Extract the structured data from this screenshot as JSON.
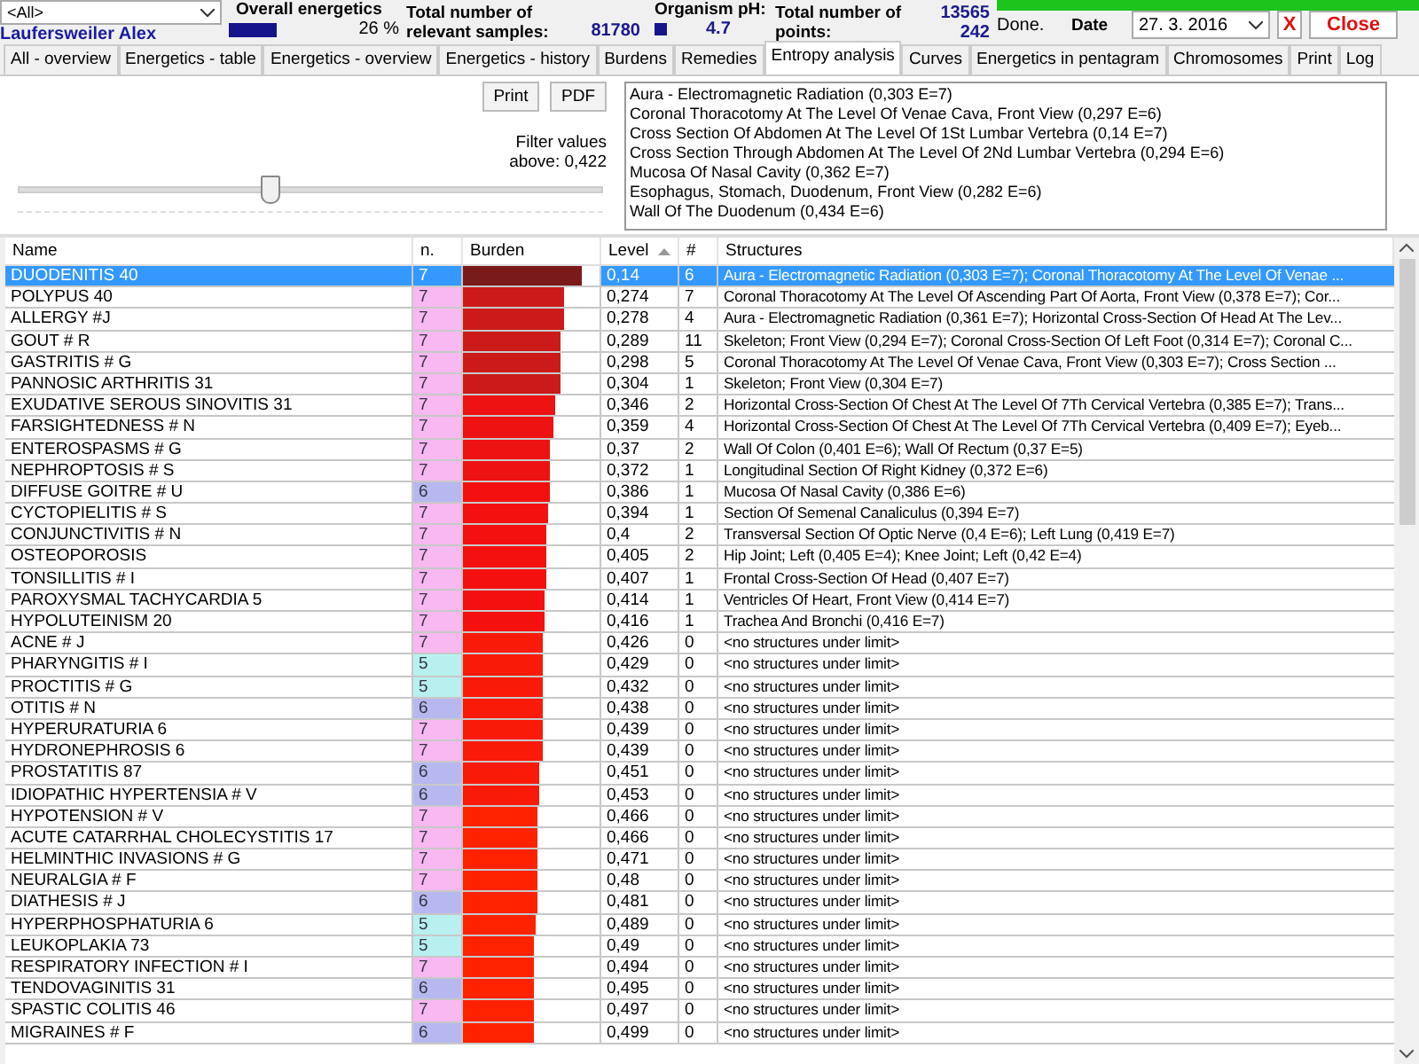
{
  "header": {
    "patient_filter": "<All>",
    "patient_name": "Laufersweiler Alex",
    "overall_label": "Overall energetics",
    "overall_value": "26 %",
    "samples_label": "Total number of relevant samples:",
    "samples_value": "81780",
    "ph_label": "Organism pH:",
    "ph_value": "4.7",
    "points_label": "Total number of points:",
    "points_value_1": "13565",
    "points_value_2": "242",
    "progress": {
      "level": 1
    },
    "status": "Done.",
    "date_label": "Date",
    "date_value": "27. 3. 2016",
    "clear_button": "X",
    "close_button": "Close"
  },
  "tabs": [
    {
      "label": "All - overview",
      "selected": false
    },
    {
      "label": "Energetics - table",
      "selected": false
    },
    {
      "label": "Energetics - overview",
      "selected": false
    },
    {
      "label": "Energetics - history",
      "selected": false
    },
    {
      "label": "Burdens",
      "selected": false
    },
    {
      "label": "Remedies",
      "selected": false
    },
    {
      "label": "Entropy analysis",
      "selected": true
    },
    {
      "label": "Curves",
      "selected": false
    },
    {
      "label": "Energetics in pentagram",
      "selected": false
    },
    {
      "label": "Chromosomes",
      "selected": false
    },
    {
      "label": "Print",
      "selected": false
    },
    {
      "label": "Log",
      "selected": false
    }
  ],
  "panel": {
    "buttons": [
      "Print",
      "PDF"
    ],
    "filter_label": "Filter values above: 0,422",
    "filter_slider": {
      "level": 0.43
    },
    "structures_list": [
      "Aura - Electromagnetic Radiation (0,303 E=7)",
      "Coronal Thoracotomy At The Level Of Venae Cava, Front View (0,297 E=6)",
      "Cross Section Of Abdomen At The Level Of 1St Lumbar Vertebra (0,14 E=7)",
      "Cross Section Through Abdomen At The Level Of 2Nd Lumbar Vertebra (0,294 E=6)",
      "Mucosa Of Nasal Cavity (0,362 E=7)",
      "Esophagus, Stomach, Duodenum, Front View (0,282 E=6)",
      "Wall Of The Duodenum (0,434 E=6)"
    ]
  },
  "table": {
    "columns": [
      "Name",
      "n.",
      "Burden",
      "Level",
      "#",
      "Structures"
    ],
    "rows": [
      {
        "name": "DUODENITIS  40",
        "n": "7",
        "burden": {
          "level": 0.87,
          "color": "#7a1a1a"
        },
        "level": "0,14",
        "count": "6",
        "structures": "Aura - Electromagnetic Radiation (0,303 E=7); Coronal Thoracotomy At The Level Of Venae ...",
        "selected": true
      },
      {
        "name": "POLYPUS  40",
        "n": "7",
        "color": "#f8b8f0",
        "burden": {
          "level": 0.74,
          "color": "#cc1a1a"
        },
        "level": "0,274",
        "count": "7",
        "structures": "Coronal Thoracotomy At The Level Of Ascending Part Of Aorta, Front View (0,378 E=7); Cor...",
        "selected": false
      },
      {
        "name": "ALLERGY #J",
        "n": "7",
        "color": "#f8b8f0",
        "burden": {
          "level": 0.74,
          "color": "#cc1a1a"
        },
        "level": "0,278",
        "count": "4",
        "structures": "Aura - Electromagnetic Radiation (0,361 E=7); Horizontal Cross-Section Of Head At The Lev...",
        "selected": false
      },
      {
        "name": "GOUT # R",
        "n": "7",
        "color": "#f8b8f0",
        "burden": {
          "level": 0.72,
          "color": "#cc1a1a"
        },
        "level": "0,289",
        "count": "11",
        "structures": "Skeleton; Front View (0,294 E=7); Coronal Cross-Section Of Left Foot (0,314 E=7); Coronal C...",
        "selected": false
      },
      {
        "name": "GASTRITIS  # G",
        "n": "7",
        "color": "#f8b8f0",
        "burden": {
          "level": 0.71,
          "color": "#cc1a1a"
        },
        "level": "0,298",
        "count": "5",
        "structures": "Coronal Thoracotomy At The Level Of Venae Cava, Front View (0,303 E=7); Cross Section ...",
        "selected": false
      },
      {
        "name": "PANNOSIC  ARTHRITIS  31",
        "n": "7",
        "color": "#f8b8f0",
        "burden": {
          "level": 0.71,
          "color": "#cc1a1a"
        },
        "level": "0,304",
        "count": "1",
        "structures": "Skeleton; Front View (0,304 E=7)",
        "selected": false
      },
      {
        "name": "EXUDATIVE  SEROUS  SINOVITIS  31",
        "n": "7",
        "color": "#f8b8f0",
        "burden": {
          "level": 0.67,
          "color": "#ee1212"
        },
        "level": "0,346",
        "count": "2",
        "structures": "Horizontal Cross-Section Of Chest At The Level Of 7Th Cervical Vertebra (0,385 E=7); Trans...",
        "selected": false
      },
      {
        "name": "FARSIGHTEDNESS  # N",
        "n": "7",
        "color": "#f8b8f0",
        "burden": {
          "level": 0.66,
          "color": "#ee1212"
        },
        "level": "0,359",
        "count": "4",
        "structures": "Horizontal Cross-Section Of Chest At The Level Of 7Th Cervical Vertebra (0,409 E=7); Eyeb...",
        "selected": false
      },
      {
        "name": "ENTEROSPASMS  # G",
        "n": "7",
        "color": "#f8b8f0",
        "burden": {
          "level": 0.64,
          "color": "#ee1212"
        },
        "level": "0,37",
        "count": "2",
        "structures": "Wall Of Colon (0,401 E=6); Wall Of Rectum (0,37 E=5)",
        "selected": false
      },
      {
        "name": "NEPHROPTOSIS # S",
        "n": "7",
        "color": "#f8b8f0",
        "burden": {
          "level": 0.64,
          "color": "#ee1212"
        },
        "level": "0,372",
        "count": "1",
        "structures": "Longitudinal Section Of Right Kidney (0,372 E=6)",
        "selected": false
      },
      {
        "name": "DIFFUSE GOITRE    # U",
        "n": "6",
        "color": "#b8b8f0",
        "burden": {
          "level": 0.63,
          "color": "#f51010"
        },
        "level": "0,386",
        "count": "1",
        "structures": "Mucosa Of Nasal Cavity (0,386 E=6)",
        "selected": false
      },
      {
        "name": "CYCTOPIELITIS # S",
        "n": "7",
        "color": "#f8b8f0",
        "burden": {
          "level": 0.62,
          "color": "#f51010"
        },
        "level": "0,394",
        "count": "1",
        "structures": "Section Of Semenal Canaliculus (0,394 E=7)",
        "selected": false
      },
      {
        "name": "CONJUNCTIVITIS # N",
        "n": "7",
        "color": "#f8b8f0",
        "burden": {
          "level": 0.61,
          "color": "#f51010"
        },
        "level": "0,4",
        "count": "2",
        "structures": "Transversal Section Of Optic Nerve (0,4 E=6); Left Lung (0,419 E=7)",
        "selected": false
      },
      {
        "name": "OSTEOPOROSIS",
        "n": "7",
        "color": "#f8b8f0",
        "burden": {
          "level": 0.61,
          "color": "#f51010"
        },
        "level": "0,405",
        "count": "2",
        "structures": "Hip Joint; Left (0,405 E=4); Knee Joint; Left (0,42 E=4)",
        "selected": false
      },
      {
        "name": "TONSILLITIS  # I",
        "n": "7",
        "color": "#f8b8f0",
        "burden": {
          "level": 0.61,
          "color": "#f51010"
        },
        "level": "0,407",
        "count": "1",
        "structures": "Frontal Cross-Section Of Head (0,407 E=7)",
        "selected": false
      },
      {
        "name": "PAROXYSMAL  TACHYCARDIA  5",
        "n": "7",
        "color": "#f8b8f0",
        "burden": {
          "level": 0.6,
          "color": "#f51010"
        },
        "level": "0,414",
        "count": "1",
        "structures": "Ventricles Of Heart, Front View (0,414 E=7)",
        "selected": false
      },
      {
        "name": "HYPOLUTEINISM  20",
        "n": "7",
        "color": "#f8b8f0",
        "burden": {
          "level": 0.6,
          "color": "#f51010"
        },
        "level": "0,416",
        "count": "1",
        "structures": "Trachea And Bronchi (0,416 E=7)",
        "selected": false
      },
      {
        "name": "ACNE  # J",
        "n": "7",
        "color": "#f8b8f0",
        "burden": {
          "level": 0.59,
          "color": "#fa1a08"
        },
        "level": "0,426",
        "count": "0",
        "structures": "<no structures under limit>",
        "selected": false
      },
      {
        "name": "PHARYNGITIS # I",
        "n": "5",
        "color": "#b8f0f0",
        "burden": {
          "level": 0.59,
          "color": "#fa1a08"
        },
        "level": "0,429",
        "count": "0",
        "structures": "<no structures under limit>",
        "selected": false
      },
      {
        "name": "PROCTITIS # G",
        "n": "5",
        "color": "#b8f0f0",
        "burden": {
          "level": 0.58,
          "color": "#fa1a08"
        },
        "level": "0,432",
        "count": "0",
        "structures": "<no structures under limit>",
        "selected": false
      },
      {
        "name": "OTITIS #  N",
        "n": "6",
        "color": "#b8b8f0",
        "burden": {
          "level": 0.58,
          "color": "#fa1a08"
        },
        "level": "0,438",
        "count": "0",
        "structures": "<no structures under limit>",
        "selected": false
      },
      {
        "name": "HYPERURATURIA  6",
        "n": "7",
        "color": "#f8b8f0",
        "burden": {
          "level": 0.58,
          "color": "#fa1a08"
        },
        "level": "0,439",
        "count": "0",
        "structures": "<no structures under limit>",
        "selected": false
      },
      {
        "name": "HYDRONEPHROSIS  6",
        "n": "7",
        "color": "#f8b8f0",
        "burden": {
          "level": 0.58,
          "color": "#fa1a08"
        },
        "level": "0,439",
        "count": "0",
        "structures": "<no structures under limit>",
        "selected": false
      },
      {
        "name": "PROSTATITIS    87",
        "n": "6",
        "color": "#b8b8f0",
        "burden": {
          "level": 0.56,
          "color": "#fa1a08"
        },
        "level": "0,451",
        "count": "0",
        "structures": "<no structures under limit>",
        "selected": false
      },
      {
        "name": "IDIOPATHIC  HYPERTENSIA  # V",
        "n": "6",
        "color": "#b8b8f0",
        "burden": {
          "level": 0.56,
          "color": "#fa1a08"
        },
        "level": "0,453",
        "count": "0",
        "structures": "<no structures under limit>",
        "selected": false
      },
      {
        "name": "HYPOTENSION # V",
        "n": "7",
        "color": "#f8b8f0",
        "burden": {
          "level": 0.54,
          "color": "#ff2200"
        },
        "level": "0,466",
        "count": "0",
        "structures": "<no structures under limit>",
        "selected": false
      },
      {
        "name": "ACUTE  CATARRHAL  CHOLECYSTITIS  17",
        "n": "7",
        "color": "#f8b8f0",
        "burden": {
          "level": 0.54,
          "color": "#ff2200"
        },
        "level": "0,466",
        "count": "0",
        "structures": "<no structures under limit>",
        "selected": false
      },
      {
        "name": "HELMINTHIC  INVASIONS  # G",
        "n": "7",
        "color": "#f8b8f0",
        "burden": {
          "level": 0.54,
          "color": "#ff2200"
        },
        "level": "0,471",
        "count": "0",
        "structures": "<no structures under limit>",
        "selected": false
      },
      {
        "name": "NEURALGIA  # F",
        "n": "7",
        "color": "#f8b8f0",
        "burden": {
          "level": 0.54,
          "color": "#ff2200"
        },
        "level": "0,48",
        "count": "0",
        "structures": "<no structures under limit>",
        "selected": false
      },
      {
        "name": "DIATHESIS # J",
        "n": "6",
        "color": "#b8b8f0",
        "burden": {
          "level": 0.54,
          "color": "#ff2200"
        },
        "level": "0,481",
        "count": "0",
        "structures": "<no structures under limit>",
        "selected": false
      },
      {
        "name": "HYPERPHOSPHATURIA  6",
        "n": "5",
        "color": "#b8f0f0",
        "burden": {
          "level": 0.53,
          "color": "#ff2200"
        },
        "level": "0,489",
        "count": "0",
        "structures": "<no structures under limit>",
        "selected": false
      },
      {
        "name": "LEUKOPLAKIA  73",
        "n": "5",
        "color": "#b8f0f0",
        "burden": {
          "level": 0.52,
          "color": "#ff2200"
        },
        "level": "0,49",
        "count": "0",
        "structures": "<no structures under limit>",
        "selected": false
      },
      {
        "name": "RESPIRATORY  INFECTION  # I",
        "n": "7",
        "color": "#f8b8f0",
        "burden": {
          "level": 0.52,
          "color": "#ff2200"
        },
        "level": "0,494",
        "count": "0",
        "structures": "<no structures under limit>",
        "selected": false
      },
      {
        "name": "TENDOVAGINITIS  31",
        "n": "6",
        "color": "#b8b8f0",
        "burden": {
          "level": 0.52,
          "color": "#ff2200"
        },
        "level": "0,495",
        "count": "0",
        "structures": "<no structures under limit>",
        "selected": false
      },
      {
        "name": "SPASTIC  COLITIS  46",
        "n": "7",
        "color": "#f8b8f0",
        "burden": {
          "level": 0.52,
          "color": "#ff2200"
        },
        "level": "0,497",
        "count": "0",
        "structures": "<no structures under limit>",
        "selected": false
      },
      {
        "name": "MIGRAINES # F",
        "n": "6",
        "color": "#b8b8f0",
        "burden": {
          "level": 0.52,
          "color": "#ff2200"
        },
        "level": "0,499",
        "count": "0",
        "structures": "<no structures under limit>",
        "selected": false
      }
    ]
  }
}
